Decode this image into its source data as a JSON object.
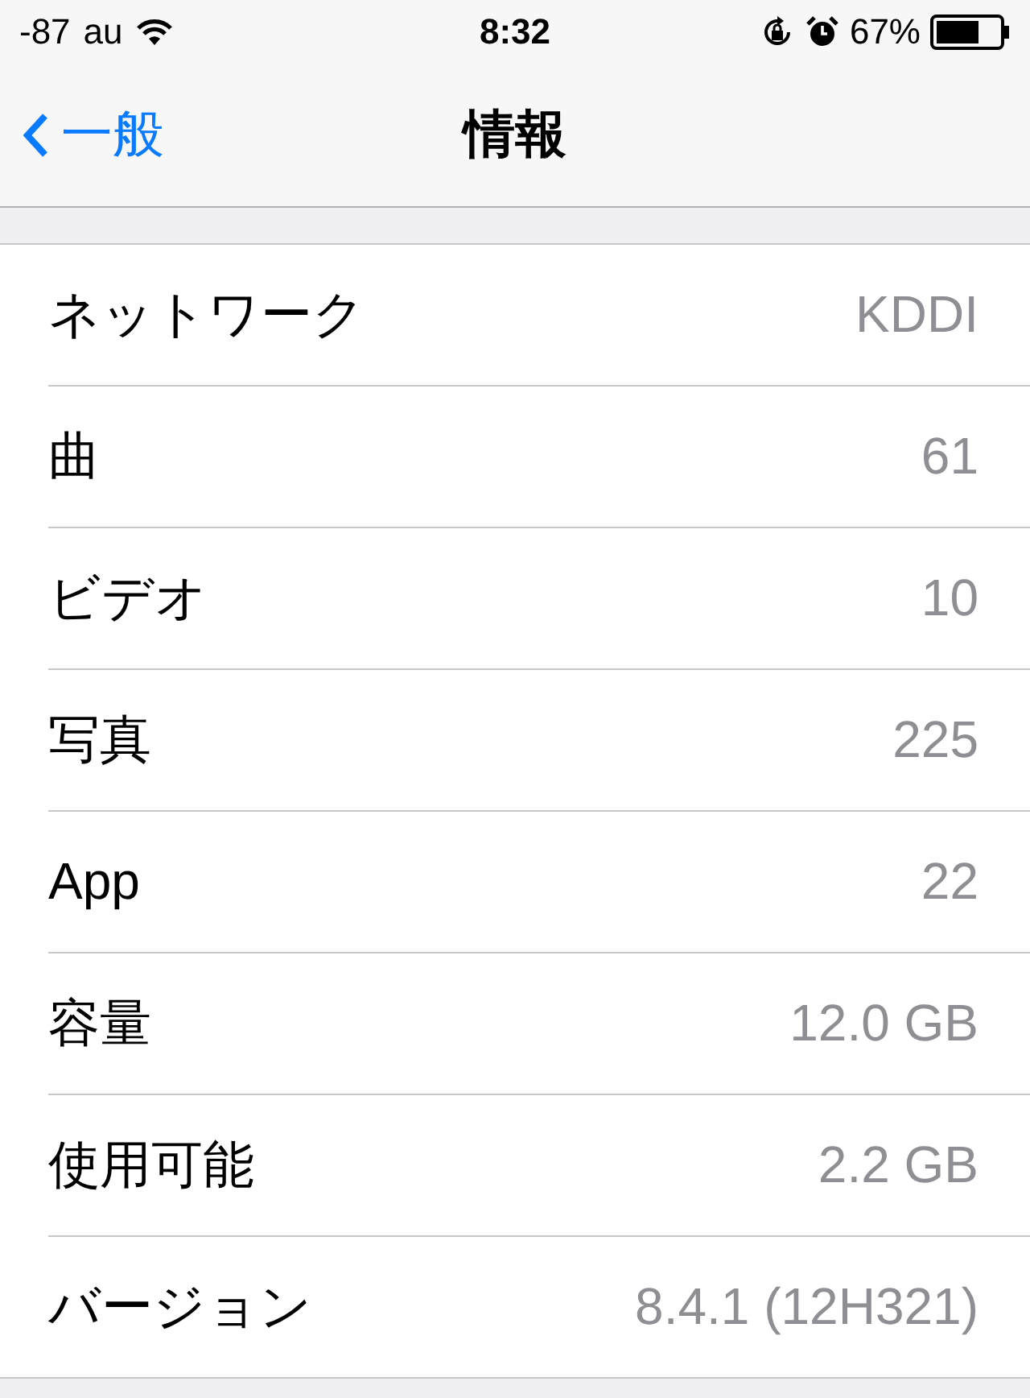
{
  "status_bar": {
    "signal": "-87",
    "carrier": "au",
    "time": "8:32",
    "battery": "67%"
  },
  "nav": {
    "back": "一般",
    "title": "情報"
  },
  "rows": [
    {
      "label": "ネットワーク",
      "value": "KDDI"
    },
    {
      "label": "曲",
      "value": "61"
    },
    {
      "label": "ビデオ",
      "value": "10"
    },
    {
      "label": "写真",
      "value": "225"
    },
    {
      "label": "App",
      "value": "22"
    },
    {
      "label": "容量",
      "value": "12.0 GB"
    },
    {
      "label": "使用可能",
      "value": "2.2 GB"
    },
    {
      "label": "バージョン",
      "value": "8.4.1 (12H321)"
    }
  ]
}
